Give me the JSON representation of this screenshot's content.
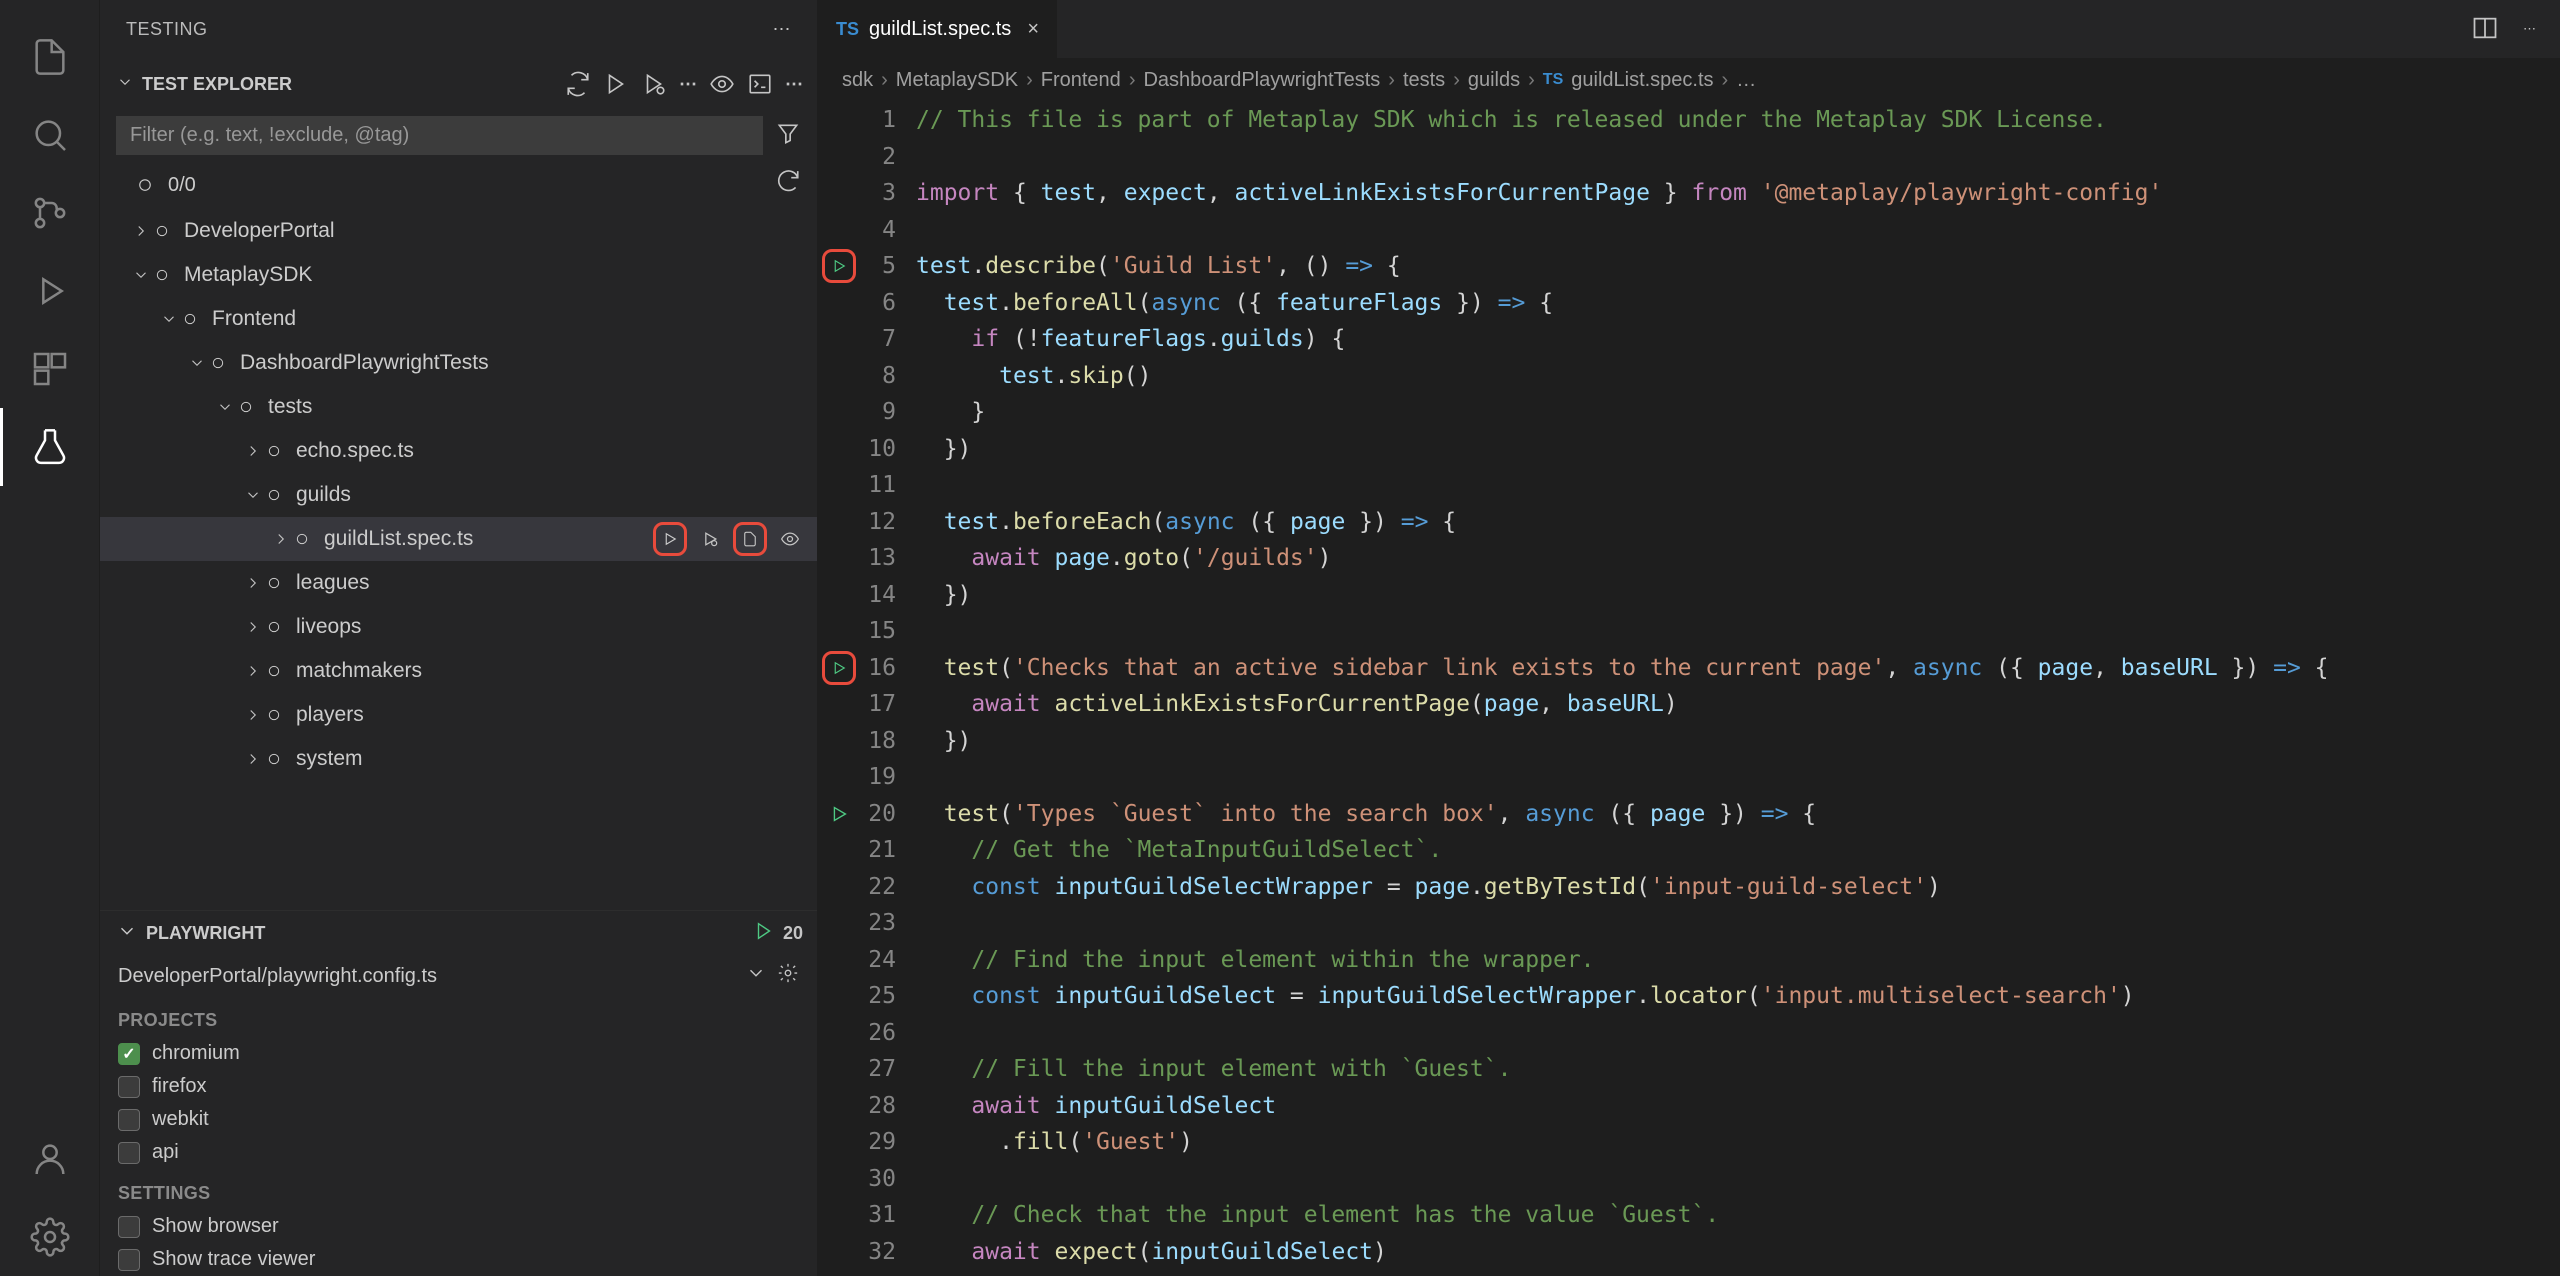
{
  "activityBar": {
    "items": [
      "files",
      "search",
      "source-control",
      "run-debug",
      "extensions",
      "testing"
    ],
    "activeIndex": 5
  },
  "sidebar": {
    "title": "TESTING",
    "testExplorer": {
      "title": "TEST EXPLORER",
      "filterPlaceholder": "Filter (e.g. text, !exclude, @tag)",
      "count": "0/0"
    },
    "tree": [
      {
        "depth": 0,
        "chev": "right",
        "label": "DeveloperPortal"
      },
      {
        "depth": 0,
        "chev": "down",
        "label": "MetaplaySDK"
      },
      {
        "depth": 1,
        "chev": "down",
        "label": "Frontend"
      },
      {
        "depth": 2,
        "chev": "down",
        "label": "DashboardPlaywrightTests"
      },
      {
        "depth": 3,
        "chev": "down",
        "label": "tests"
      },
      {
        "depth": 4,
        "chev": "right",
        "label": "echo.spec.ts"
      },
      {
        "depth": 4,
        "chev": "down",
        "label": "guilds"
      },
      {
        "depth": 5,
        "chev": "right",
        "label": "guildList.spec.ts",
        "selected": true,
        "actions": true
      },
      {
        "depth": 4,
        "chev": "right",
        "label": "leagues"
      },
      {
        "depth": 4,
        "chev": "right",
        "label": "liveops"
      },
      {
        "depth": 4,
        "chev": "right",
        "label": "matchmakers"
      },
      {
        "depth": 4,
        "chev": "right",
        "label": "players"
      },
      {
        "depth": 4,
        "chev": "right",
        "label": "system"
      }
    ],
    "playwright": {
      "title": "PLAYWRIGHT",
      "config": "DeveloperPortal/playwright.config.ts",
      "projectsLabel": "PROJECTS",
      "projects": [
        {
          "name": "chromium",
          "checked": true
        },
        {
          "name": "firefox",
          "checked": false
        },
        {
          "name": "webkit",
          "checked": false
        },
        {
          "name": "api",
          "checked": false
        }
      ],
      "settingsLabel": "SETTINGS",
      "settings": [
        {
          "name": "Show browser",
          "checked": false
        },
        {
          "name": "Show trace viewer",
          "checked": false
        }
      ]
    }
  },
  "editor": {
    "tab": {
      "icon": "TS",
      "name": "guildList.spec.ts"
    },
    "breadcrumbs": [
      "sdk",
      "MetaplaySDK",
      "Frontend",
      "DashboardPlaywrightTests",
      "tests",
      "guilds",
      "guildList.spec.ts",
      "…"
    ],
    "gutterMarkers": [
      {
        "line": 5,
        "type": "play-red"
      },
      {
        "line": 16,
        "type": "play-red"
      },
      {
        "line": 20,
        "type": "play-green"
      }
    ],
    "lines": [
      [
        [
          "cmt",
          "// This file is part of Metaplay SDK which is released under the Metaplay SDK License."
        ]
      ],
      [],
      [
        [
          "kw",
          "import"
        ],
        [
          "pn",
          " { "
        ],
        [
          "var",
          "test"
        ],
        [
          "pn",
          ", "
        ],
        [
          "var",
          "expect"
        ],
        [
          "pn",
          ", "
        ],
        [
          "var",
          "activeLinkExistsForCurrentPage"
        ],
        [
          "pn",
          " } "
        ],
        [
          "kw",
          "from"
        ],
        [
          "pn",
          " "
        ],
        [
          "str",
          "'@metaplay/playwright-config'"
        ]
      ],
      [],
      [
        [
          "var",
          "test"
        ],
        [
          "pn",
          "."
        ],
        [
          "fn",
          "describe"
        ],
        [
          "pn",
          "("
        ],
        [
          "str",
          "'Guild List'"
        ],
        [
          "pn",
          ", () "
        ],
        [
          "blue",
          "=>"
        ],
        [
          "pn",
          " {"
        ]
      ],
      [
        [
          "pn",
          "  "
        ],
        [
          "var",
          "test"
        ],
        [
          "pn",
          "."
        ],
        [
          "fn",
          "beforeAll"
        ],
        [
          "pn",
          "("
        ],
        [
          "blue",
          "async"
        ],
        [
          "pn",
          " ({ "
        ],
        [
          "var",
          "featureFlags"
        ],
        [
          "pn",
          " }) "
        ],
        [
          "blue",
          "=>"
        ],
        [
          "pn",
          " {"
        ]
      ],
      [
        [
          "pn",
          "    "
        ],
        [
          "kw",
          "if"
        ],
        [
          "pn",
          " (!"
        ],
        [
          "var",
          "featureFlags"
        ],
        [
          "pn",
          "."
        ],
        [
          "var",
          "guilds"
        ],
        [
          "pn",
          ") {"
        ]
      ],
      [
        [
          "pn",
          "      "
        ],
        [
          "var",
          "test"
        ],
        [
          "pn",
          "."
        ],
        [
          "fn",
          "skip"
        ],
        [
          "pn",
          "()"
        ]
      ],
      [
        [
          "pn",
          "    }"
        ]
      ],
      [
        [
          "pn",
          "  })"
        ]
      ],
      [],
      [
        [
          "pn",
          "  "
        ],
        [
          "var",
          "test"
        ],
        [
          "pn",
          "."
        ],
        [
          "fn",
          "beforeEach"
        ],
        [
          "pn",
          "("
        ],
        [
          "blue",
          "async"
        ],
        [
          "pn",
          " ({ "
        ],
        [
          "var",
          "page"
        ],
        [
          "pn",
          " }) "
        ],
        [
          "blue",
          "=>"
        ],
        [
          "pn",
          " {"
        ]
      ],
      [
        [
          "pn",
          "    "
        ],
        [
          "kw",
          "await"
        ],
        [
          "pn",
          " "
        ],
        [
          "var",
          "page"
        ],
        [
          "pn",
          "."
        ],
        [
          "fn",
          "goto"
        ],
        [
          "pn",
          "("
        ],
        [
          "str",
          "'/guilds'"
        ],
        [
          "pn",
          ")"
        ]
      ],
      [
        [
          "pn",
          "  })"
        ]
      ],
      [],
      [
        [
          "pn",
          "  "
        ],
        [
          "fn",
          "test"
        ],
        [
          "pn",
          "("
        ],
        [
          "str",
          "'Checks that an active sidebar link exists to the current page'"
        ],
        [
          "pn",
          ", "
        ],
        [
          "blue",
          "async"
        ],
        [
          "pn",
          " ({ "
        ],
        [
          "var",
          "page"
        ],
        [
          "pn",
          ", "
        ],
        [
          "var",
          "baseURL"
        ],
        [
          "pn",
          " }) "
        ],
        [
          "blue",
          "=>"
        ],
        [
          "pn",
          " {"
        ]
      ],
      [
        [
          "pn",
          "    "
        ],
        [
          "kw",
          "await"
        ],
        [
          "pn",
          " "
        ],
        [
          "fn",
          "activeLinkExistsForCurrentPage"
        ],
        [
          "pn",
          "("
        ],
        [
          "var",
          "page"
        ],
        [
          "pn",
          ", "
        ],
        [
          "var",
          "baseURL"
        ],
        [
          "pn",
          ")"
        ]
      ],
      [
        [
          "pn",
          "  })"
        ]
      ],
      [],
      [
        [
          "pn",
          "  "
        ],
        [
          "fn",
          "test"
        ],
        [
          "pn",
          "("
        ],
        [
          "str",
          "'Types `Guest` into the search box'"
        ],
        [
          "pn",
          ", "
        ],
        [
          "blue",
          "async"
        ],
        [
          "pn",
          " ({ "
        ],
        [
          "var",
          "page"
        ],
        [
          "pn",
          " }) "
        ],
        [
          "blue",
          "=>"
        ],
        [
          "pn",
          " {"
        ]
      ],
      [
        [
          "pn",
          "    "
        ],
        [
          "cmt",
          "// Get the `MetaInputGuildSelect`."
        ]
      ],
      [
        [
          "pn",
          "    "
        ],
        [
          "blue",
          "const"
        ],
        [
          "pn",
          " "
        ],
        [
          "var",
          "inputGuildSelectWrapper"
        ],
        [
          "pn",
          " = "
        ],
        [
          "var",
          "page"
        ],
        [
          "pn",
          "."
        ],
        [
          "fn",
          "getByTestId"
        ],
        [
          "pn",
          "("
        ],
        [
          "str",
          "'input-guild-select'"
        ],
        [
          "pn",
          ")"
        ]
      ],
      [],
      [
        [
          "pn",
          "    "
        ],
        [
          "cmt",
          "// Find the input element within the wrapper."
        ]
      ],
      [
        [
          "pn",
          "    "
        ],
        [
          "blue",
          "const"
        ],
        [
          "pn",
          " "
        ],
        [
          "var",
          "inputGuildSelect"
        ],
        [
          "pn",
          " = "
        ],
        [
          "var",
          "inputGuildSelectWrapper"
        ],
        [
          "pn",
          "."
        ],
        [
          "fn",
          "locator"
        ],
        [
          "pn",
          "("
        ],
        [
          "str",
          "'input.multiselect-search'"
        ],
        [
          "pn",
          ")"
        ]
      ],
      [],
      [
        [
          "pn",
          "    "
        ],
        [
          "cmt",
          "// Fill the input element with `Guest`."
        ]
      ],
      [
        [
          "pn",
          "    "
        ],
        [
          "kw",
          "await"
        ],
        [
          "pn",
          " "
        ],
        [
          "var",
          "inputGuildSelect"
        ]
      ],
      [
        [
          "pn",
          "      ."
        ],
        [
          "fn",
          "fill"
        ],
        [
          "pn",
          "("
        ],
        [
          "str",
          "'Guest'"
        ],
        [
          "pn",
          ")"
        ]
      ],
      [],
      [
        [
          "pn",
          "    "
        ],
        [
          "cmt",
          "// Check that the input element has the value `Guest`."
        ]
      ],
      [
        [
          "pn",
          "    "
        ],
        [
          "kw",
          "await"
        ],
        [
          "pn",
          " "
        ],
        [
          "fn",
          "expect"
        ],
        [
          "pn",
          "("
        ],
        [
          "var",
          "inputGuildSelect"
        ],
        [
          "pn",
          ")"
        ]
      ]
    ]
  }
}
